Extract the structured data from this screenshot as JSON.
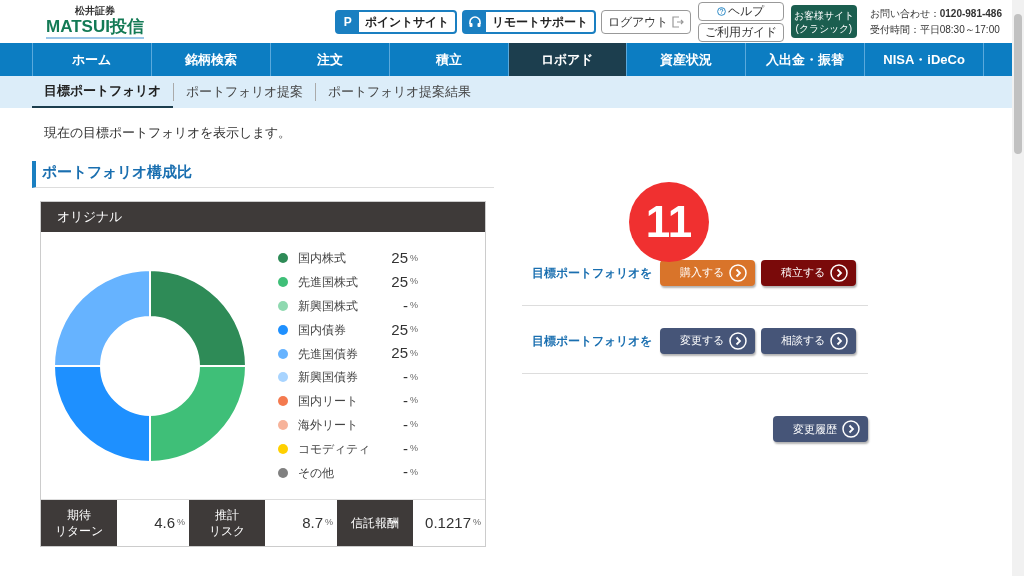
{
  "header": {
    "logo_small": "松井証券",
    "logo_main": "MATSUI",
    "logo_sub": "投信",
    "point_button": {
      "icon": "P",
      "label": "ポイントサイト"
    },
    "remote_button": "リモートサポート",
    "logout_button": "ログアウト",
    "help_link": "ヘルプ",
    "guide_link": "ご利用ガイド",
    "classic_button": [
      "お客様サイト",
      "(クラシック)"
    ],
    "contact_label": "お問い合わせ：",
    "contact_phone": "0120-981-486",
    "hours": "受付時間：平日08:30～17:00"
  },
  "nav": [
    {
      "label": "ホーム",
      "selected": false
    },
    {
      "label": "銘柄検索",
      "selected": false
    },
    {
      "label": "注文",
      "selected": false
    },
    {
      "label": "積立",
      "selected": false
    },
    {
      "label": "ロボアド",
      "selected": true
    },
    {
      "label": "資産状況",
      "selected": false
    },
    {
      "label": "入出金・振替",
      "selected": false
    },
    {
      "label": "NISA・iDeCo",
      "selected": false
    }
  ],
  "subnav": [
    {
      "label": "目標ポートフォリオ",
      "selected": true
    },
    {
      "label": "ポートフォリオ提案",
      "selected": false
    },
    {
      "label": "ポートフォリオ提案結果",
      "selected": false
    }
  ],
  "intro": "現在の目標ポートフォリオを表示します。",
  "section_title": "ポートフォリオ構成比",
  "card": {
    "title": "オリジナル",
    "legend": [
      {
        "value": "25",
        "unit": "%",
        "color": "#2e8b57"
      },
      {
        "value": "25",
        "unit": "%",
        "color": "#3fbf78"
      },
      {
        "value": "-",
        "unit": "%",
        "color": "#8fd9b0"
      },
      {
        "value": "25",
        "unit": "%",
        "color": "#1e90ff"
      },
      {
        "value": "25",
        "unit": "%",
        "color": "#66b3ff"
      },
      {
        "value": "-",
        "unit": "%",
        "color": "#a8d4ff"
      },
      {
        "value": "-",
        "unit": "%",
        "color": "#f47a4f"
      },
      {
        "value": "-",
        "unit": "%",
        "color": "#f7b39a"
      },
      {
        "value": "-",
        "unit": "%",
        "color": "#ffd000"
      },
      {
        "value": "-",
        "unit": "%",
        "color": "#808080"
      }
    ],
    "chart_data": {
      "type": "donut",
      "categories": [
        "国内株式",
        "先進国株式",
        "新興国株式",
        "国内債券",
        "先進国債券",
        "新興国債券",
        "国内リート",
        "海外リート",
        "コモディティ",
        "その他"
      ],
      "values": [
        25,
        25,
        null,
        25,
        25,
        null,
        null,
        null,
        null,
        null
      ]
    },
    "stats": [
      {
        "label": [
          "期待",
          "リターン"
        ],
        "value": "4.6",
        "unit": "%"
      },
      {
        "label": [
          "推計",
          "リスク"
        ],
        "value": "8.7",
        "unit": "%"
      },
      {
        "label": [
          "信託報酬"
        ],
        "value": "0.1217",
        "unit": "%"
      }
    ]
  },
  "actions": [
    {
      "label": "目標ポートフォリオを",
      "buttons": [
        {
          "label": "購入する",
          "kind": "orange"
        },
        {
          "label": "積立する",
          "kind": "maroon"
        }
      ]
    },
    {
      "label": "目標ポートフォリオを",
      "buttons": [
        {
          "label": "変更する",
          "kind": "navy"
        },
        {
          "label": "相談する",
          "kind": "navy"
        }
      ]
    }
  ],
  "history_button": "変更履歴",
  "step_badge": "11"
}
